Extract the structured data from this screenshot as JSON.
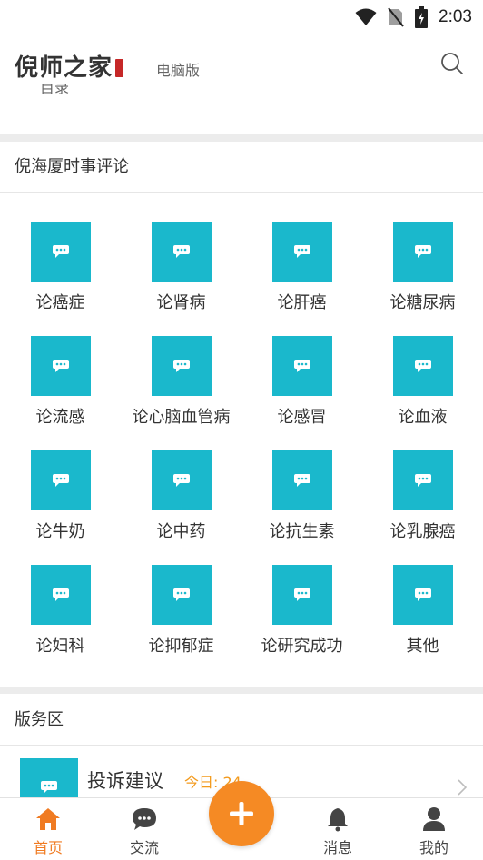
{
  "status_bar": {
    "time": "2:03"
  },
  "header": {
    "logo": "倪师之家",
    "pc_link": "电脑版",
    "icons": [
      "search-icon"
    ]
  },
  "cut_text": "目录",
  "section1": {
    "title": "倪海厦时事评论",
    "items": [
      {
        "label": "论癌症"
      },
      {
        "label": "论肾病"
      },
      {
        "label": "论肝癌"
      },
      {
        "label": "论糖尿病"
      },
      {
        "label": "论流感"
      },
      {
        "label": "论心脑血管病"
      },
      {
        "label": "论感冒"
      },
      {
        "label": "论血液"
      },
      {
        "label": "论牛奶"
      },
      {
        "label": "论中药"
      },
      {
        "label": "论抗生素"
      },
      {
        "label": "论乳腺癌"
      },
      {
        "label": "论妇科"
      },
      {
        "label": "论抑郁症"
      },
      {
        "label": "论研究成功"
      },
      {
        "label": "其他"
      }
    ]
  },
  "section2": {
    "title": "版务区",
    "forum": {
      "name": "投诉建议",
      "today": "今日: 24"
    }
  },
  "bottom_nav": {
    "items": [
      {
        "label": "首页",
        "icon": "home-icon",
        "active": true
      },
      {
        "label": "交流",
        "icon": "chat-icon"
      },
      {
        "label": "消息",
        "icon": "bell-icon"
      },
      {
        "label": "我的",
        "icon": "user-icon"
      }
    ],
    "fab_icon": "plus-icon"
  },
  "colors": {
    "accent": "#f07b22",
    "tile": "#1ab8cc"
  }
}
